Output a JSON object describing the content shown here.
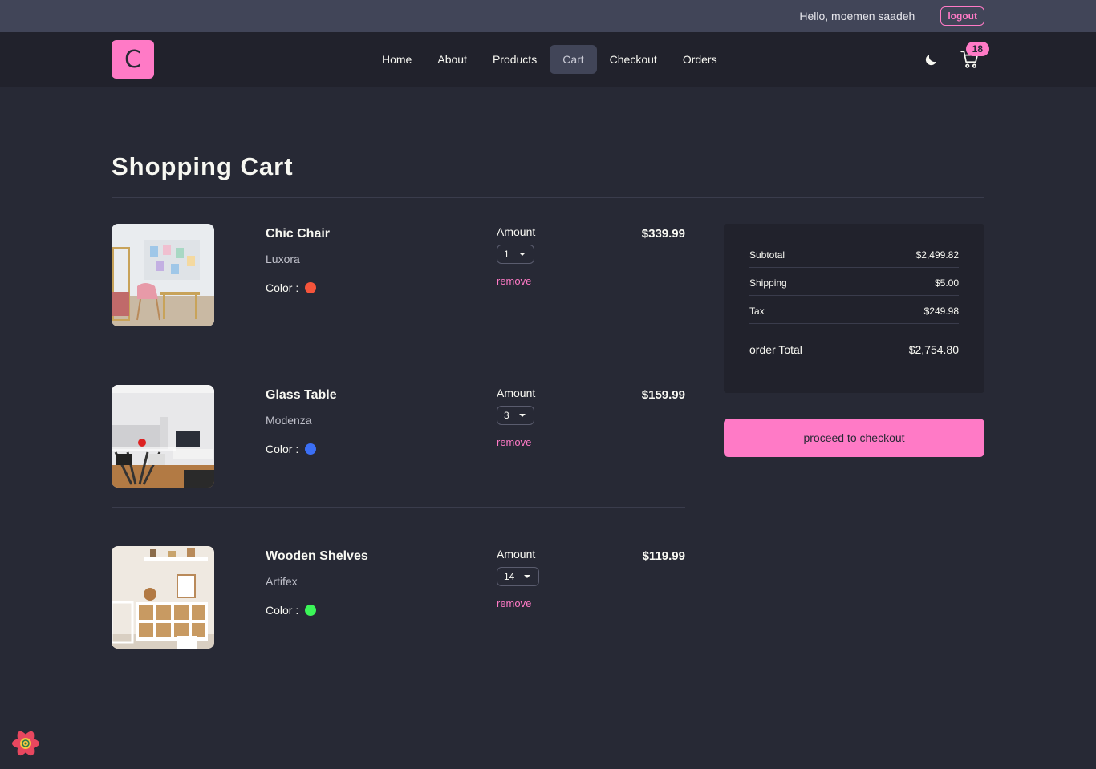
{
  "topbar": {
    "greeting": "Hello, moemen saadeh",
    "logout_label": "logout"
  },
  "navbar": {
    "logo_letter": "C",
    "links": [
      "Home",
      "About",
      "Products",
      "Cart",
      "Checkout",
      "Orders"
    ],
    "active": "Cart",
    "cart_count": "18"
  },
  "page": {
    "title": "Shopping Cart"
  },
  "cart_items": [
    {
      "name": "Chic Chair",
      "company": "Luxora",
      "color_label": "Color :",
      "color": "#f5543b",
      "amount_label": "Amount",
      "quantity": "1",
      "remove_label": "remove",
      "price": "$339.99"
    },
    {
      "name": "Glass Table",
      "company": "Modenza",
      "color_label": "Color :",
      "color": "#3b6ff5",
      "amount_label": "Amount",
      "quantity": "3",
      "remove_label": "remove",
      "price": "$159.99"
    },
    {
      "name": "Wooden Shelves",
      "company": "Artifex",
      "color_label": "Color :",
      "color": "#3bf558",
      "amount_label": "Amount",
      "quantity": "14",
      "remove_label": "remove",
      "price": "$119.99"
    }
  ],
  "summary": {
    "subtotal_label": "Subtotal",
    "subtotal": "$2,499.82",
    "shipping_label": "Shipping",
    "shipping": "$5.00",
    "tax_label": "Tax",
    "tax": "$249.98",
    "total_label": "order Total",
    "total": "$2,754.80"
  },
  "checkout_button": "proceed to checkout",
  "colors": {
    "accent": "#ff7ac6",
    "background": "#272935",
    "navbar": "#21222c",
    "topbar": "#414558"
  }
}
